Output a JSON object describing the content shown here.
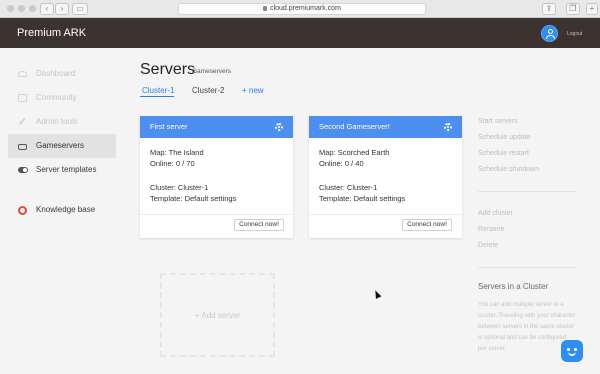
{
  "browser": {
    "url": "cloud.premiumark.com",
    "back_icon": "chevron-left-icon",
    "forward_icon": "chevron-right-icon"
  },
  "header": {
    "brand": "Premium ARK",
    "logout_label": "Logout",
    "avatar_icon": "user-avatar-icon"
  },
  "sidebar": {
    "items": [
      {
        "label": "Dashboard",
        "icon": "dashboard-icon",
        "state": "disabled"
      },
      {
        "label": "Community",
        "icon": "community-icon",
        "state": "disabled"
      },
      {
        "label": "Admin tools",
        "icon": "wrench-icon",
        "state": "disabled"
      },
      {
        "label": "Gameservers",
        "icon": "server-icon",
        "state": "active"
      },
      {
        "label": "Server templates",
        "icon": "toggle-icon",
        "state": "normal"
      },
      {
        "label": "Knowledge base",
        "icon": "lifebuoy-icon",
        "state": "normal"
      }
    ]
  },
  "main": {
    "title": "Servers",
    "subtitle": "Gameservers",
    "tabs": [
      {
        "label": "Cluster-1",
        "active": true
      },
      {
        "label": "Cluster-2",
        "active": false
      },
      {
        "label": "+ new",
        "active": false
      }
    ],
    "servers": [
      {
        "name": "First server",
        "map": "Map: The Island",
        "online": "Online: 0 / 70",
        "cluster": "Cluster: Cluster-1",
        "template": "Template: Default settings",
        "connect_label": "Connect now!"
      },
      {
        "name": "Second Gameserver!",
        "map": "Map: Scorched Earth",
        "online": "Online: 0 / 40",
        "cluster": "Cluster: Cluster-1",
        "template": "Template: Default settings",
        "connect_label": "Connect now!"
      }
    ],
    "add_server_label": "+ Add server"
  },
  "right_panel": {
    "actions": [
      "Start servers",
      "Schedule update",
      "Schedule restart",
      "Schedule shutdown"
    ],
    "cluster_actions": [
      "Add cluster",
      "Rename",
      "Delete"
    ],
    "info_title": "Servers in a Cluster",
    "info_text": "You can add multiple server to a cluster. Traveling with your character between servers in the same cluster is optional and can be configured per server."
  },
  "colors": {
    "accent": "#2f7de3",
    "card_header": "#4d8ff0",
    "topbar": "#3c3331",
    "knowledge_icon": "#e24b3b"
  }
}
